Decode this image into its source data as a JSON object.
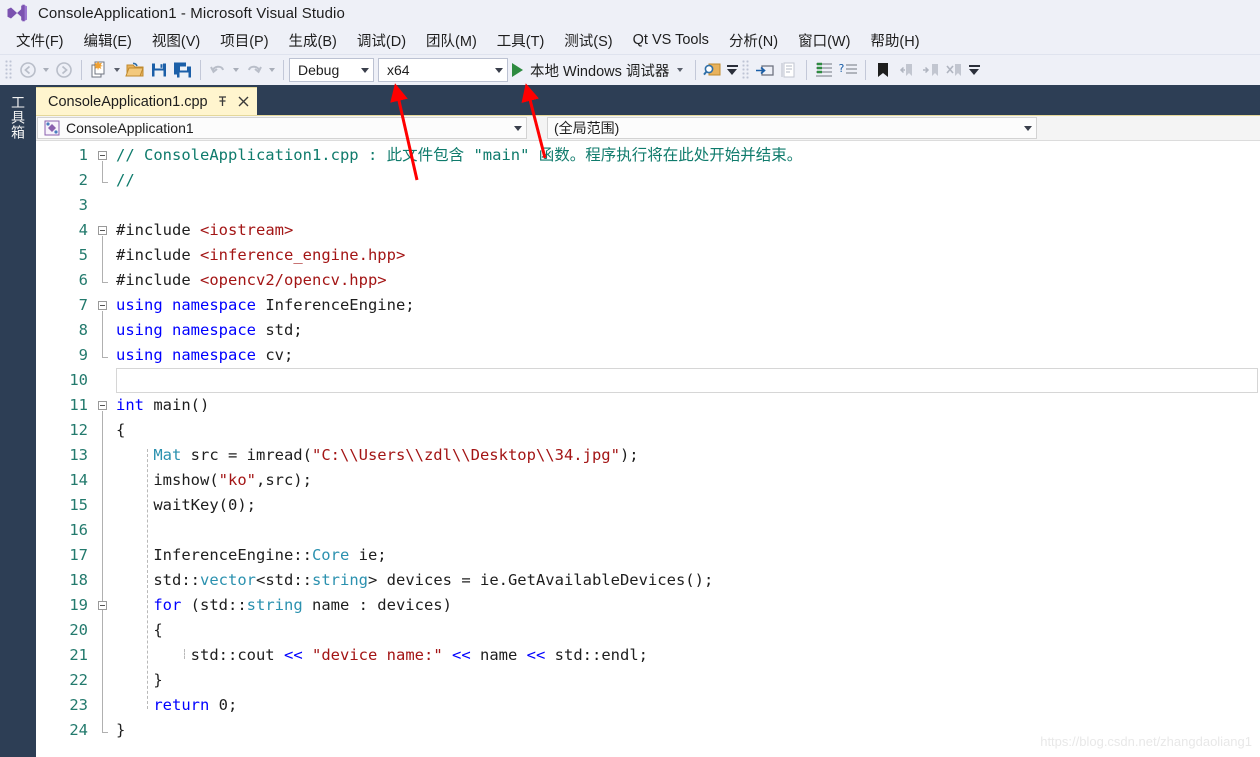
{
  "window": {
    "title": "ConsoleApplication1 - Microsoft Visual Studio",
    "logo_icon": "visual-studio-logo"
  },
  "menubar": [
    {
      "label": "文件(F)"
    },
    {
      "label": "编辑(E)"
    },
    {
      "label": "视图(V)"
    },
    {
      "label": "项目(P)"
    },
    {
      "label": "生成(B)"
    },
    {
      "label": "调试(D)"
    },
    {
      "label": "团队(M)"
    },
    {
      "label": "工具(T)"
    },
    {
      "label": "测试(S)"
    },
    {
      "label": "Qt VS Tools"
    },
    {
      "label": "分析(N)"
    },
    {
      "label": "窗口(W)"
    },
    {
      "label": "帮助(H)"
    }
  ],
  "toolbar": {
    "configuration": "Debug",
    "platform": "x64",
    "run_label": "本地 Windows 调试器",
    "icons": [
      "navigate-back-icon",
      "navigate-forward-icon",
      "new-project-icon",
      "open-file-icon",
      "save-icon",
      "save-all-icon",
      "undo-icon",
      "redo-icon",
      "play-icon",
      "find-icon",
      "step-icon",
      "comment-icon",
      "indent-icon",
      "help-icon",
      "bookmark-icon",
      "previous-bookmark-icon",
      "next-bookmark-icon",
      "clear-bookmarks-icon"
    ]
  },
  "toolbox": {
    "label": "工具箱"
  },
  "tab": {
    "title": "ConsoleApplication1.cpp",
    "pin_icon": "pin-icon",
    "close_icon": "close-icon"
  },
  "navbar": {
    "project": "ConsoleApplication1",
    "project_icon": "cpp-project-icon",
    "scope": "(全局范围)"
  },
  "editor": {
    "line_numbers": [
      1,
      2,
      3,
      4,
      5,
      6,
      7,
      8,
      9,
      10,
      11,
      12,
      13,
      14,
      15,
      16,
      17,
      18,
      19,
      20,
      21,
      22,
      23,
      24
    ],
    "current_line": 10,
    "lines": [
      {
        "n": 1,
        "tokens": [
          {
            "t": "// ConsoleApplication1.cpp : 此文件包含 \"main\" 函数。程序执行将在此处开始并结束。",
            "c": "cm"
          }
        ]
      },
      {
        "n": 2,
        "tokens": [
          {
            "t": "//",
            "c": "cm"
          }
        ]
      },
      {
        "n": 3,
        "tokens": []
      },
      {
        "n": 4,
        "tokens": [
          {
            "t": "#include ",
            "c": "pp"
          },
          {
            "t": "<iostream>",
            "c": "inc"
          }
        ]
      },
      {
        "n": 5,
        "tokens": [
          {
            "t": "#include ",
            "c": "pp"
          },
          {
            "t": "<inference_engine.hpp>",
            "c": "inc"
          }
        ]
      },
      {
        "n": 6,
        "tokens": [
          {
            "t": "#include ",
            "c": "pp"
          },
          {
            "t": "<opencv2/opencv.hpp>",
            "c": "inc"
          }
        ]
      },
      {
        "n": 7,
        "tokens": [
          {
            "t": "using namespace ",
            "c": "k"
          },
          {
            "t": "InferenceEngine;",
            "c": "pl"
          }
        ]
      },
      {
        "n": 8,
        "tokens": [
          {
            "t": "using namespace ",
            "c": "k"
          },
          {
            "t": "std;",
            "c": "pl"
          }
        ]
      },
      {
        "n": 9,
        "tokens": [
          {
            "t": "using namespace ",
            "c": "k"
          },
          {
            "t": "cv;",
            "c": "pl"
          }
        ]
      },
      {
        "n": 10,
        "tokens": []
      },
      {
        "n": 11,
        "tokens": [
          {
            "t": "int",
            "c": "k"
          },
          {
            "t": " main()",
            "c": "pl"
          }
        ]
      },
      {
        "n": 12,
        "tokens": [
          {
            "t": "{",
            "c": "pl"
          }
        ]
      },
      {
        "n": 13,
        "tokens": [
          {
            "t": "    ",
            "c": "pl"
          },
          {
            "t": "Mat",
            "c": "ty"
          },
          {
            "t": " src = imread(",
            "c": "pl"
          },
          {
            "t": "\"C:\\\\Users\\\\zdl\\\\Desktop\\\\34.jpg\"",
            "c": "str"
          },
          {
            "t": ");",
            "c": "pl"
          }
        ]
      },
      {
        "n": 14,
        "tokens": [
          {
            "t": "    imshow(",
            "c": "pl"
          },
          {
            "t": "\"ko\"",
            "c": "str"
          },
          {
            "t": ",src);",
            "c": "pl"
          }
        ]
      },
      {
        "n": 15,
        "tokens": [
          {
            "t": "    waitKey(0);",
            "c": "pl"
          }
        ]
      },
      {
        "n": 16,
        "tokens": []
      },
      {
        "n": 17,
        "tokens": [
          {
            "t": "    InferenceEngine::",
            "c": "pl"
          },
          {
            "t": "Core",
            "c": "ty"
          },
          {
            "t": " ie;",
            "c": "pl"
          }
        ]
      },
      {
        "n": 18,
        "tokens": [
          {
            "t": "    std::",
            "c": "pl"
          },
          {
            "t": "vector",
            "c": "ty"
          },
          {
            "t": "<std::",
            "c": "pl"
          },
          {
            "t": "string",
            "c": "ty"
          },
          {
            "t": "> devices = ie.GetAvailableDevices();",
            "c": "pl"
          }
        ]
      },
      {
        "n": 19,
        "tokens": [
          {
            "t": "    ",
            "c": "pl"
          },
          {
            "t": "for",
            "c": "k"
          },
          {
            "t": " (std::",
            "c": "pl"
          },
          {
            "t": "string",
            "c": "ty"
          },
          {
            "t": " name : devices)",
            "c": "pl"
          }
        ]
      },
      {
        "n": 20,
        "tokens": [
          {
            "t": "    {",
            "c": "pl"
          }
        ]
      },
      {
        "n": 21,
        "tokens": [
          {
            "t": "        std::cout ",
            "c": "pl"
          },
          {
            "t": "<<",
            "c": "k"
          },
          {
            "t": " ",
            "c": "pl"
          },
          {
            "t": "\"device name:\"",
            "c": "str"
          },
          {
            "t": " ",
            "c": "pl"
          },
          {
            "t": "<<",
            "c": "k"
          },
          {
            "t": " name ",
            "c": "pl"
          },
          {
            "t": "<<",
            "c": "k"
          },
          {
            "t": " std::endl;",
            "c": "pl"
          }
        ]
      },
      {
        "n": 22,
        "tokens": [
          {
            "t": "    }",
            "c": "pl"
          }
        ]
      },
      {
        "n": 23,
        "tokens": [
          {
            "t": "    ",
            "c": "pl"
          },
          {
            "t": "return",
            "c": "k"
          },
          {
            "t": " 0;",
            "c": "pl"
          }
        ]
      },
      {
        "n": 24,
        "tokens": [
          {
            "t": "}",
            "c": "pl"
          }
        ]
      }
    ]
  },
  "annotations": {
    "arrow_color": "#ff0000",
    "arrow_count": 2,
    "watermark": "https://blog.csdn.net/zhangdaoliang1"
  },
  "colors": {
    "titlebar_bg": "#eef0f7",
    "toolbox_bg": "#2d3e55",
    "tab_bg": "#fff5ce",
    "comment": "#0f7b6c",
    "keyword": "#0000ff",
    "string": "#a31515",
    "type": "#2b91af",
    "linenumber": "#237a6d"
  }
}
